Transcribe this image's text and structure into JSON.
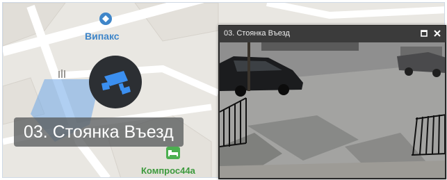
{
  "map": {
    "pois": {
      "vipaks": {
        "label": "Випакс",
        "icon": "diamond-icon"
      },
      "kompros": {
        "label": "Компрос44а",
        "icon": "bed-icon"
      }
    },
    "camera": {
      "label": "03. Стоянка Въезд",
      "icon": "cctv-camera-icon",
      "marker_color": "#2c2f33",
      "icon_color": "#3b8ff0"
    }
  },
  "video_window": {
    "title": "03. Стоянка Въезд",
    "buttons": {
      "maximize": "maximize-icon",
      "close": "close-icon"
    }
  },
  "colors": {
    "map_background": "#e9e7e2",
    "poi_blue": "#3f86c9",
    "poi_green": "#3d9a3d",
    "titlebar": "#3b3b3b"
  }
}
